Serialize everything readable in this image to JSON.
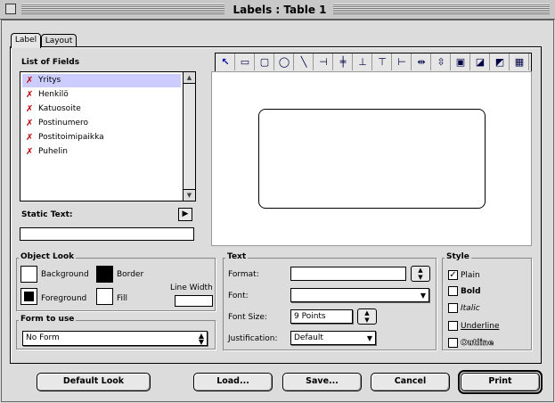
{
  "window": {
    "title": "Labels : Table 1"
  },
  "tabs": [
    {
      "label": "Label"
    },
    {
      "label": "Layout"
    }
  ],
  "fields": {
    "heading": "List of Fields",
    "items": [
      "Yritys",
      "Henkilö",
      "Katuosoite",
      "Postinumero",
      "Postitoimipaikka",
      "Puhelin"
    ]
  },
  "static_text": {
    "label": "Static Text:",
    "value": ""
  },
  "object_look": {
    "heading": "Object Look",
    "background": "Background",
    "border": "Border",
    "foreground": "Foreground",
    "fill": "Fill",
    "line_width": "Line Width",
    "line_width_value": ""
  },
  "form_to_use": {
    "heading": "Form to use",
    "value": "No Form"
  },
  "text": {
    "heading": "Text",
    "format_label": "Format:",
    "format_value": "",
    "font_label": "Font:",
    "font_value": "",
    "font_size_label": "Font Size:",
    "font_size_value": "9 Points",
    "justification_label": "Justification:",
    "justification_value": "Default"
  },
  "style": {
    "heading": "Style",
    "options": [
      {
        "label": "Plain",
        "checked": true
      },
      {
        "label": "Bold",
        "checked": false
      },
      {
        "label": "Italic",
        "checked": false
      },
      {
        "label": "Underline",
        "checked": false
      },
      {
        "label": "Outline",
        "checked": false
      }
    ]
  },
  "buttons": {
    "default_look": "Default Look",
    "load": "Load...",
    "save": "Save...",
    "cancel": "Cancel",
    "print": "Print"
  },
  "tools": [
    "arrow-tool-icon",
    "rectangle-tool-icon",
    "rounded-rectangle-tool-icon",
    "oval-tool-icon",
    "line-tool-icon",
    "align-left-icon",
    "align-center-h-icon",
    "align-bottom-icon",
    "align-top-icon",
    "align-right-icon",
    "distribute-h-icon",
    "distribute-v-icon",
    "group-icon",
    "bring-front-icon",
    "send-back-icon",
    "object-properties-icon"
  ],
  "colors": {
    "selection": "#ccccff",
    "chrome": "#dcdcdc"
  }
}
